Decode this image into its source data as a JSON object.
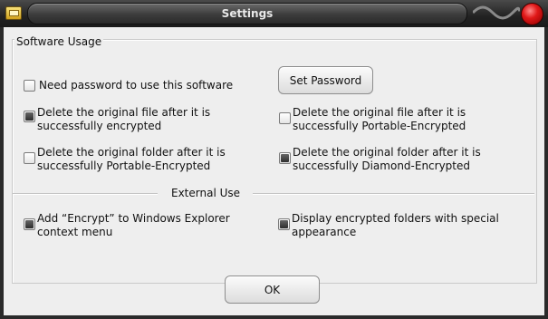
{
  "window": {
    "title": "Settings"
  },
  "software_usage": {
    "group_title": "Software Usage",
    "set_password_label": "Set Password",
    "options": [
      {
        "label": "Need password to use this software",
        "checked": false
      },
      {
        "label": "Delete the original file after it is successfully encrypted",
        "checked": true
      },
      {
        "label": "Delete the original file after it is successfully Portable-Encrypted",
        "checked": false
      },
      {
        "label": "Delete the original folder after it is successfully Portable-Encrypted",
        "checked": false
      },
      {
        "label": "Delete the original folder after it is successfully Diamond-Encrypted",
        "checked": true
      }
    ]
  },
  "external_use": {
    "section_title": "External Use",
    "options": [
      {
        "label": "Add “Encrypt” to Windows Explorer context menu",
        "checked": true
      },
      {
        "label": "Display encrypted folders with special appearance",
        "checked": true
      }
    ]
  },
  "footer": {
    "ok_label": "OK"
  }
}
